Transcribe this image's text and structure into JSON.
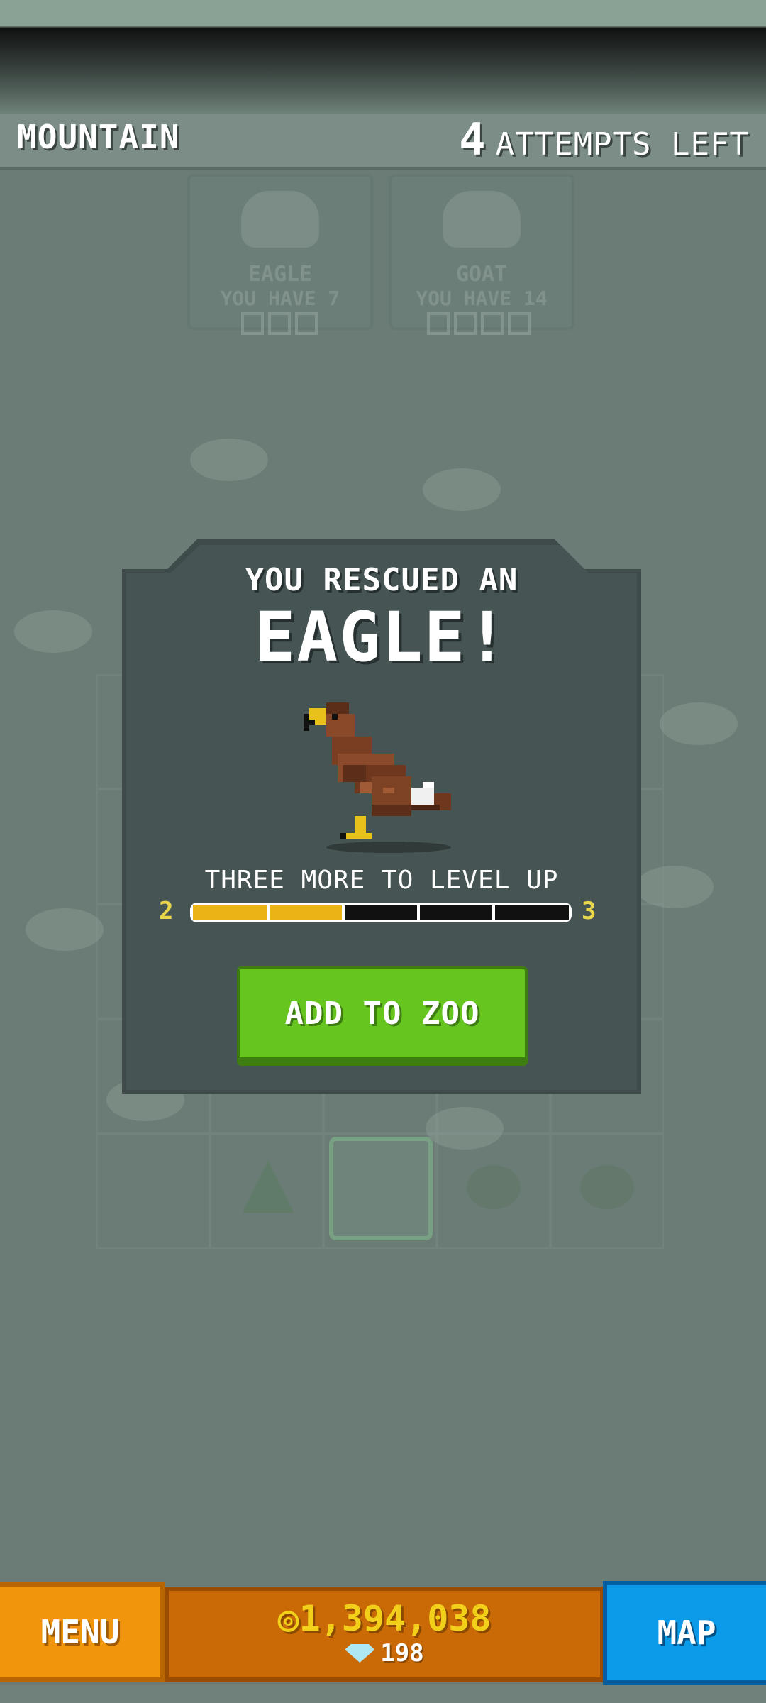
{
  "header": {
    "level_name": "MOUNTAIN",
    "attempts_count": "4",
    "attempts_label": "ATTEMPTS LEFT"
  },
  "background_cards": [
    {
      "name": "EAGLE",
      "have": "YOU HAVE 7"
    },
    {
      "name": "GOAT",
      "have": "YOU HAVE 14"
    }
  ],
  "modal": {
    "title_line1": "YOU RESCUED AN",
    "title_line2": "EAGLE!",
    "animal_icon": "eagle-sprite",
    "levelup_text": "THREE MORE TO LEVEL UP",
    "level_from": "2",
    "level_to": "3",
    "progress_fraction": 0.4,
    "progress_segments": 5,
    "add_button": "ADD TO ZOO"
  },
  "footer": {
    "menu_label": "MENU",
    "coins": "1,394,038",
    "gems": "198",
    "map_label": "MAP"
  },
  "colors": {
    "add_button": "#66c61f",
    "menu_button": "#f0950c",
    "map_button": "#0c9be8",
    "progress_fill": "#eab417"
  }
}
